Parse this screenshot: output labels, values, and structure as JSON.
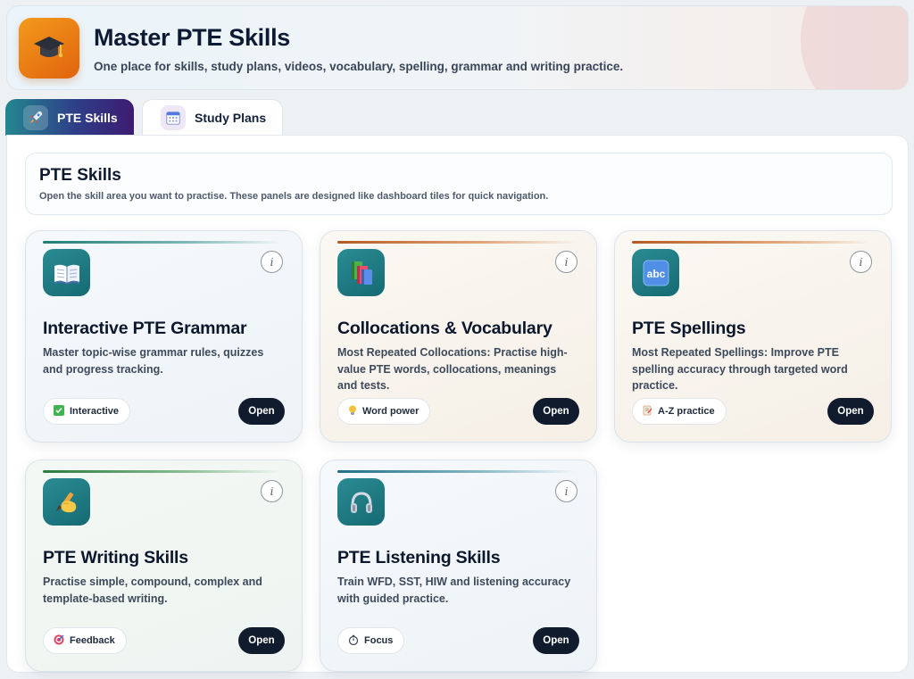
{
  "header": {
    "title": "Master PTE Skills",
    "subtitle": "One place for skills, study plans, videos, vocabulary, spelling, grammar and writing practice.",
    "logo_icon": "graduation-cap-icon",
    "accent_color": "#f08d1a"
  },
  "tabs": [
    {
      "label": "PTE Skills",
      "icon": "rocket-icon",
      "active": true
    },
    {
      "label": "Study Plans",
      "icon": "calendar-icon",
      "active": false
    }
  ],
  "section": {
    "title": "PTE Skills",
    "description": "Open the skill area you want to practise. These panels are designed like dashboard tiles for quick navigation."
  },
  "cards": [
    {
      "title": "Interactive PTE Grammar",
      "description": "Master topic-wise grammar rules, quizzes and progress tracking.",
      "icon": "open-book-icon",
      "chip_icon": "check-box-icon",
      "chip_label": "Interactive",
      "button_label": "Open",
      "info_label": "i"
    },
    {
      "title": "Collocations & Vocabulary",
      "description": "Most Repeated Collocations: Practise high-value PTE words, collocations, meanings and tests.",
      "icon": "books-icon",
      "chip_icon": "light-bulb-icon",
      "chip_label": "Word power",
      "button_label": "Open",
      "info_label": "i"
    },
    {
      "title": "PTE Spellings",
      "description": "Most Repeated Spellings: Improve PTE spelling accuracy through targeted word practice.",
      "icon": "abc-icon",
      "chip_icon": "memo-icon",
      "chip_label": "A-Z practice",
      "button_label": "Open",
      "info_label": "i"
    },
    {
      "title": "PTE Writing Skills",
      "description": "Practise simple, compound, complex and template-based writing.",
      "icon": "writing-hand-icon",
      "chip_icon": "target-icon",
      "chip_label": "Feedback",
      "button_label": "Open",
      "info_label": "i"
    },
    {
      "title": "PTE Listening Skills",
      "description": "Train WFD, SST, HIW and listening accuracy with guided practice.",
      "icon": "headphones-icon",
      "chip_icon": "stopwatch-icon",
      "chip_label": "Focus",
      "button_label": "Open",
      "info_label": "i"
    }
  ]
}
